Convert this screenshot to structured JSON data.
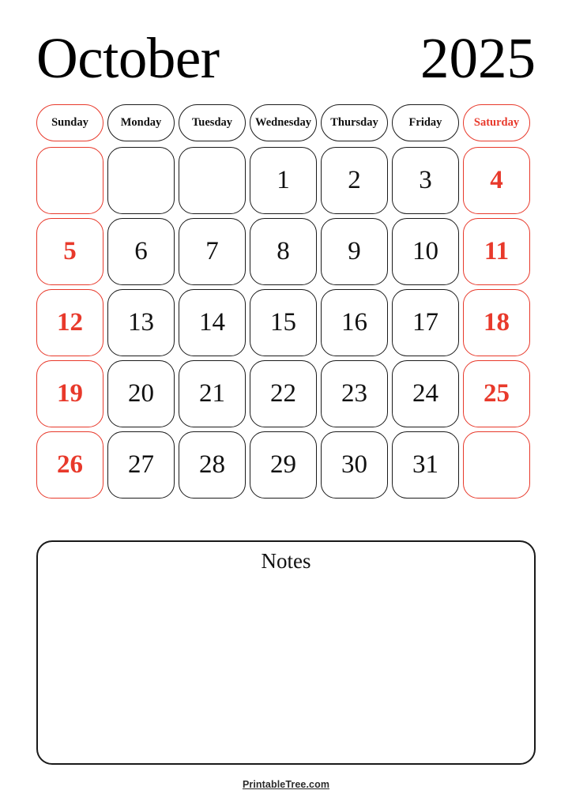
{
  "header": {
    "month": "October",
    "year": "2025"
  },
  "weekdays": [
    {
      "label": "Sunday",
      "weekend_border": true,
      "weekend_text": false
    },
    {
      "label": "Monday",
      "weekend_border": false,
      "weekend_text": false
    },
    {
      "label": "Tuesday",
      "weekend_border": false,
      "weekend_text": false
    },
    {
      "label": "Wednesday",
      "weekend_border": false,
      "weekend_text": false
    },
    {
      "label": "Thursday",
      "weekend_border": false,
      "weekend_text": false
    },
    {
      "label": "Friday",
      "weekend_border": false,
      "weekend_text": false
    },
    {
      "label": "Saturday",
      "weekend_border": true,
      "weekend_text": true
    }
  ],
  "weeks": [
    [
      "",
      "",
      "",
      "1",
      "2",
      "3",
      "4"
    ],
    [
      "5",
      "6",
      "7",
      "8",
      "9",
      "10",
      "11"
    ],
    [
      "12",
      "13",
      "14",
      "15",
      "16",
      "17",
      "18"
    ],
    [
      "19",
      "20",
      "21",
      "22",
      "23",
      "24",
      "25"
    ],
    [
      "26",
      "27",
      "28",
      "29",
      "30",
      "31",
      ""
    ]
  ],
  "notes": {
    "title": "Notes"
  },
  "footer": {
    "brand": "PrintableTree.com"
  },
  "colors": {
    "weekend_red": "#e8392b",
    "ink": "#111111",
    "border": "#1a1a1a",
    "page_background": "#ffffff",
    "footer_text": "#2b2b2b"
  }
}
